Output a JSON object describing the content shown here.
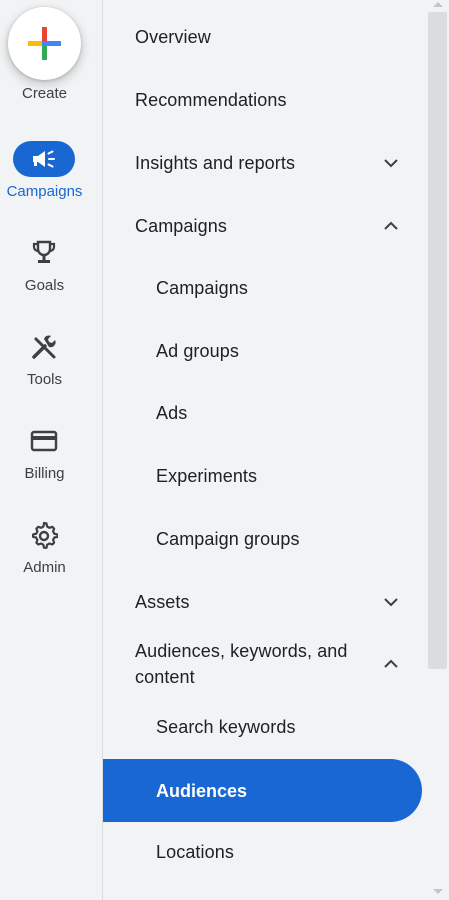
{
  "rail": {
    "create": "Create",
    "campaigns": "Campaigns",
    "goals": "Goals",
    "tools": "Tools",
    "billing": "Billing",
    "admin": "Admin"
  },
  "nav": {
    "overview": "Overview",
    "recommendations": "Recommendations",
    "insights": "Insights and reports",
    "campaigns_group": "Campaigns",
    "campaigns": "Campaigns",
    "ad_groups": "Ad groups",
    "ads": "Ads",
    "experiments": "Experiments",
    "campaign_groups": "Campaign groups",
    "assets": "Assets",
    "audiences_line1": "Audiences, keywords, and",
    "audiences_line2": "content",
    "search_keywords": "Search keywords",
    "audiences": "Audiences",
    "locations": "Locations"
  },
  "colors": {
    "accent": "#1967d2",
    "background": "#f1f3f4"
  }
}
